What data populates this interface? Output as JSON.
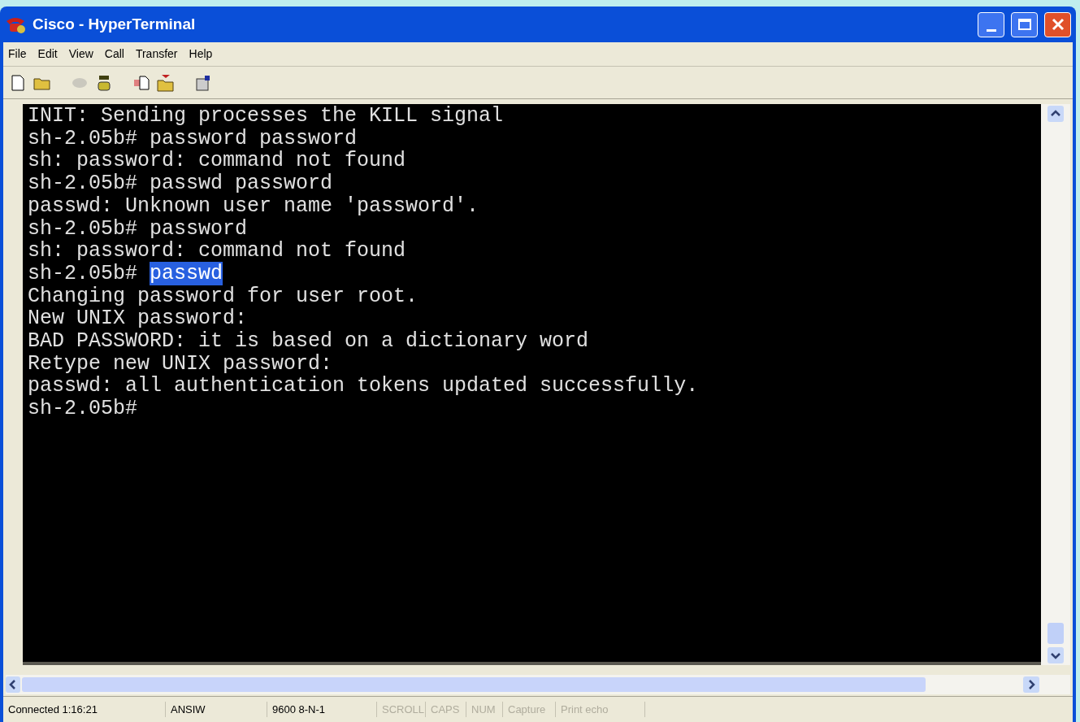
{
  "window": {
    "title": "Cisco - HyperTerminal"
  },
  "menu": [
    "File",
    "Edit",
    "View",
    "Call",
    "Transfer",
    "Help"
  ],
  "terminal": {
    "lines": [
      {
        "text": "INIT: Sending processes the KILL signal"
      },
      {
        "text": "sh-2.05b# password password"
      },
      {
        "text": "sh: password: command not found"
      },
      {
        "text": "sh-2.05b# passwd password"
      },
      {
        "text": "passwd: Unknown user name 'password'."
      },
      {
        "text": "sh-2.05b# password"
      },
      {
        "text": "sh: password: command not found"
      },
      {
        "text": "sh-2.05b# ",
        "selection": "passwd"
      },
      {
        "text": "Changing password for user root."
      },
      {
        "text": "New UNIX password:"
      },
      {
        "text": "BAD PASSWORD: it is based on a dictionary word"
      },
      {
        "text": "Retype new UNIX password:"
      },
      {
        "text": "passwd: all authentication tokens updated successfully."
      },
      {
        "text": "sh-2.05b#"
      }
    ]
  },
  "status_bar": [
    {
      "text": "Connected 1:16:21",
      "disabled": false
    },
    {
      "text": "ANSIW",
      "disabled": false
    },
    {
      "text": "9600 8-N-1",
      "disabled": false
    },
    {
      "text": "SCROLL",
      "disabled": true
    },
    {
      "text": "CAPS",
      "disabled": true
    },
    {
      "text": "NUM",
      "disabled": true
    },
    {
      "text": "Capture",
      "disabled": true
    },
    {
      "text": "Print echo",
      "disabled": true
    }
  ]
}
